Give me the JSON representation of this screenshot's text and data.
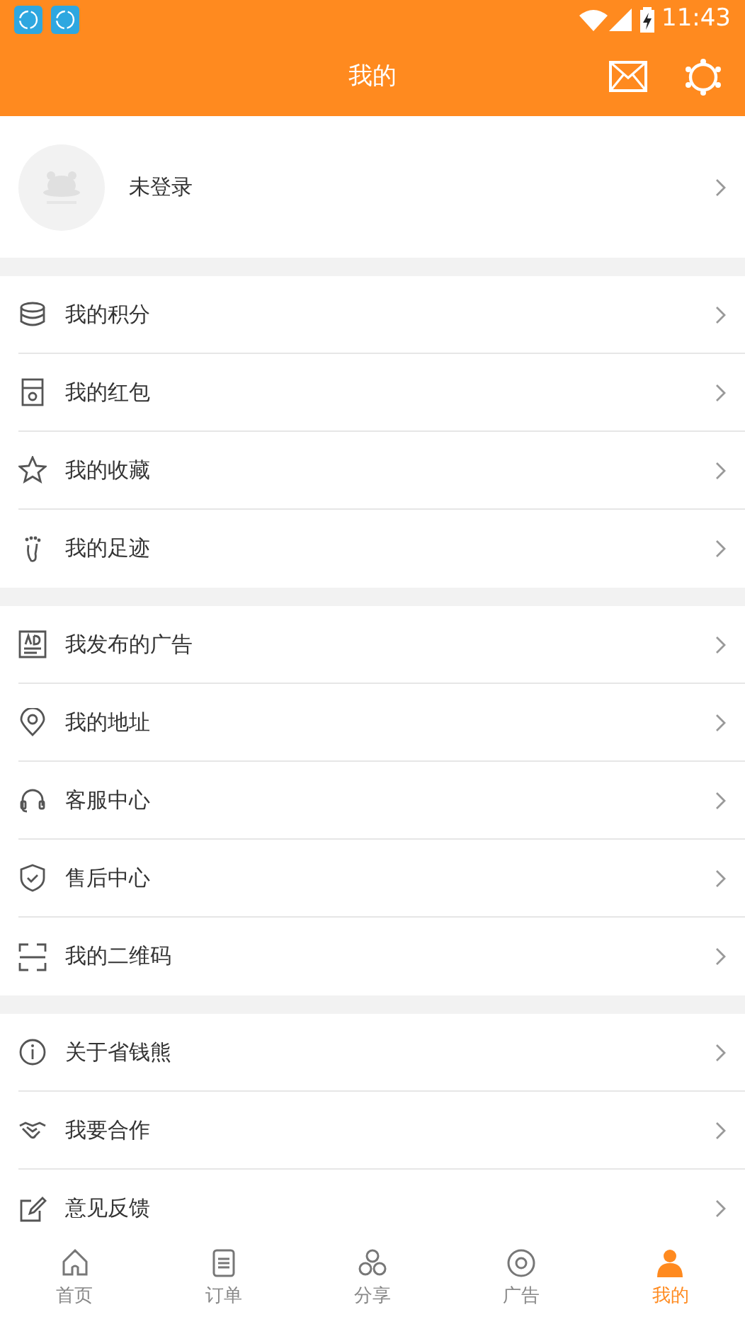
{
  "status_bar": {
    "time": "11:43"
  },
  "header": {
    "title": "我的"
  },
  "profile": {
    "name": "未登录"
  },
  "groups": [
    [
      {
        "label": "我的积分"
      },
      {
        "label": "我的红包"
      },
      {
        "label": "我的收藏"
      },
      {
        "label": "我的足迹"
      }
    ],
    [
      {
        "label": "我发布的广告"
      },
      {
        "label": "我的地址"
      },
      {
        "label": "客服中心"
      },
      {
        "label": "售后中心"
      },
      {
        "label": "我的二维码"
      }
    ],
    [
      {
        "label": "关于省钱熊"
      },
      {
        "label": "我要合作"
      },
      {
        "label": "意见反馈"
      }
    ]
  ],
  "tabs": [
    {
      "label": "首页",
      "selected": false
    },
    {
      "label": "订单",
      "selected": false
    },
    {
      "label": "分享",
      "selected": false
    },
    {
      "label": "广告",
      "selected": false
    },
    {
      "label": "我的",
      "selected": true
    }
  ]
}
